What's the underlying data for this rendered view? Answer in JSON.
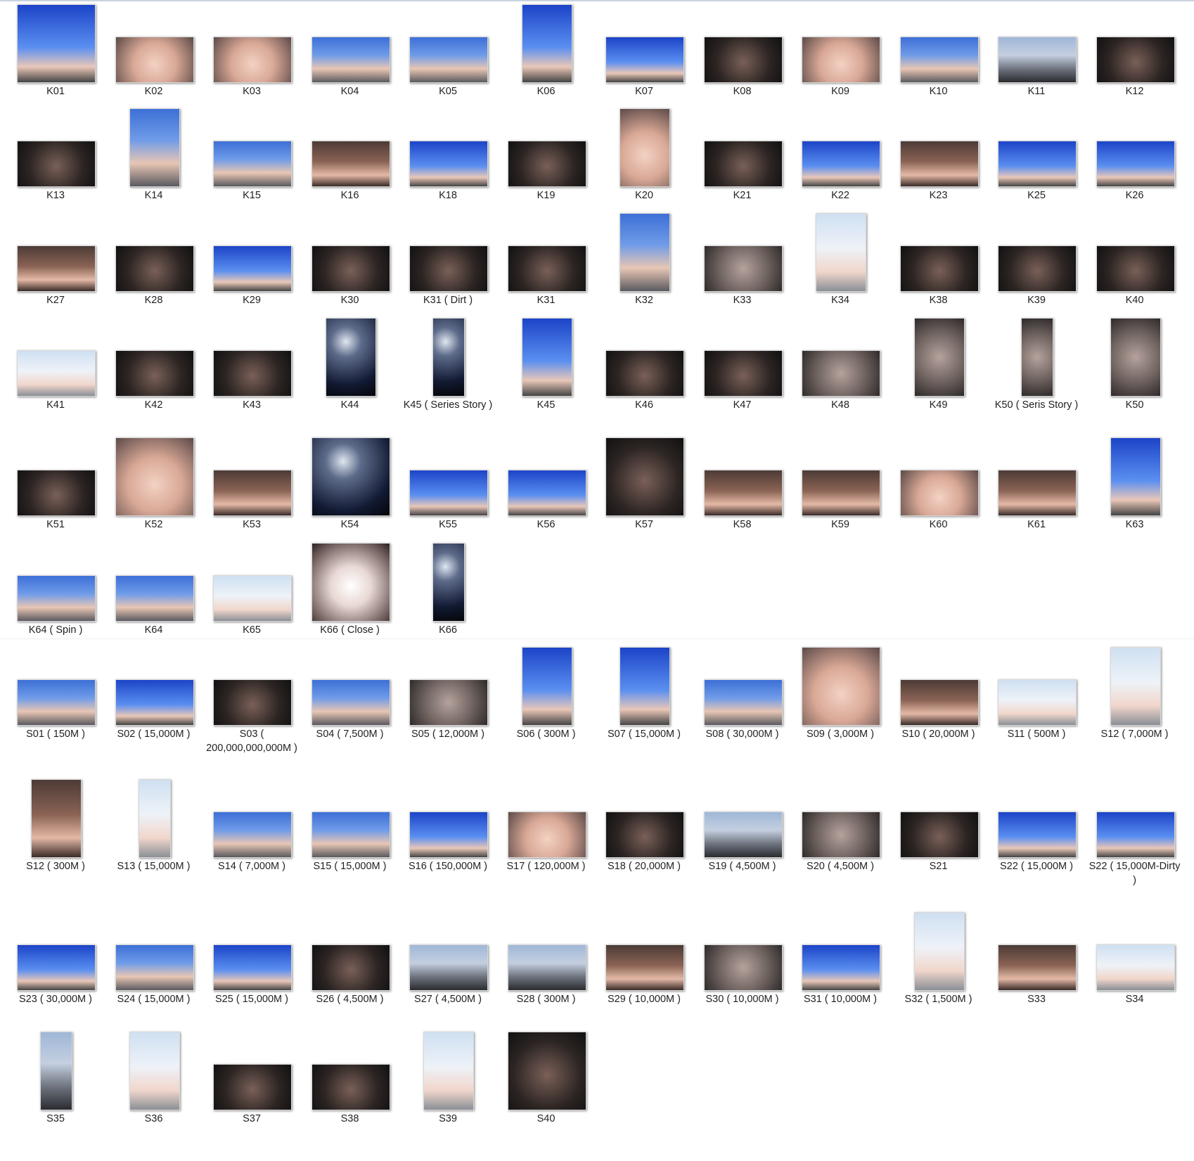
{
  "gallery": {
    "k_series": [
      {
        "label": "K01",
        "shape": "square",
        "tint": "g-blue"
      },
      {
        "label": "K02",
        "shape": "wide",
        "tint": "g-skin"
      },
      {
        "label": "K03",
        "shape": "wide",
        "tint": "g-skin"
      },
      {
        "label": "K04",
        "shape": "wide",
        "tint": "g-sky"
      },
      {
        "label": "K05",
        "shape": "wide",
        "tint": "g-sky"
      },
      {
        "label": "K06",
        "shape": "tall",
        "tint": "g-blue"
      },
      {
        "label": "K07",
        "shape": "wide",
        "tint": "g-blue"
      },
      {
        "label": "K08",
        "shape": "wide",
        "tint": "g-dark"
      },
      {
        "label": "K09",
        "shape": "wide",
        "tint": "g-skin"
      },
      {
        "label": "K10",
        "shape": "wide",
        "tint": "g-sky"
      },
      {
        "label": "K11",
        "shape": "wide",
        "tint": "g-city"
      },
      {
        "label": "K12",
        "shape": "wide",
        "tint": "g-dark"
      },
      {
        "label": "K13",
        "shape": "wide",
        "tint": "g-dark"
      },
      {
        "label": "K14",
        "shape": "tall",
        "tint": "g-sky"
      },
      {
        "label": "K15",
        "shape": "wide",
        "tint": "g-sky"
      },
      {
        "label": "K16",
        "shape": "wide",
        "tint": "g-room"
      },
      {
        "label": "K18",
        "shape": "wide",
        "tint": "g-blue"
      },
      {
        "label": "K19",
        "shape": "wide",
        "tint": "g-dark"
      },
      {
        "label": "K20",
        "shape": "tall",
        "tint": "g-skin"
      },
      {
        "label": "K21",
        "shape": "wide",
        "tint": "g-dark"
      },
      {
        "label": "K22",
        "shape": "wide",
        "tint": "g-blue"
      },
      {
        "label": "K23",
        "shape": "wide",
        "tint": "g-room"
      },
      {
        "label": "K25",
        "shape": "wide",
        "tint": "g-blue"
      },
      {
        "label": "K26",
        "shape": "wide",
        "tint": "g-blue"
      },
      {
        "label": "K27",
        "shape": "wide",
        "tint": "g-room"
      },
      {
        "label": "K28",
        "shape": "wide",
        "tint": "g-dark"
      },
      {
        "label": "K29",
        "shape": "wide",
        "tint": "g-blue"
      },
      {
        "label": "K30",
        "shape": "wide",
        "tint": "g-dark"
      },
      {
        "label": "K31 ( Dirt )",
        "shape": "wide",
        "tint": "g-dark"
      },
      {
        "label": "K31",
        "shape": "wide",
        "tint": "g-dark"
      },
      {
        "label": "K32",
        "shape": "tall",
        "tint": "g-sky"
      },
      {
        "label": "K33",
        "shape": "wide",
        "tint": "g-gray"
      },
      {
        "label": "K34",
        "shape": "tall",
        "tint": "g-pale"
      },
      {
        "label": "K38",
        "shape": "wide",
        "tint": "g-dark"
      },
      {
        "label": "K39",
        "shape": "wide",
        "tint": "g-dark"
      },
      {
        "label": "K40",
        "shape": "wide",
        "tint": "g-dark"
      },
      {
        "label": "K41",
        "shape": "wide",
        "tint": "g-pale"
      },
      {
        "label": "K42",
        "shape": "wide",
        "tint": "g-dark"
      },
      {
        "label": "K43",
        "shape": "wide",
        "tint": "g-dark"
      },
      {
        "label": "K44",
        "shape": "tall",
        "tint": "g-night"
      },
      {
        "label": "K45 ( Series Story )",
        "shape": "narrow",
        "tint": "g-night"
      },
      {
        "label": "K45",
        "shape": "tall",
        "tint": "g-blue"
      },
      {
        "label": "K46",
        "shape": "wide",
        "tint": "g-dark"
      },
      {
        "label": "K47",
        "shape": "wide",
        "tint": "g-dark"
      },
      {
        "label": "K48",
        "shape": "wide",
        "tint": "g-gray"
      },
      {
        "label": "K49",
        "shape": "tall",
        "tint": "g-gray"
      },
      {
        "label": "K50 ( Seris Story )",
        "shape": "narrow",
        "tint": "g-gray"
      },
      {
        "label": "K50",
        "shape": "tall",
        "tint": "g-gray"
      },
      {
        "label": "K51",
        "shape": "wide",
        "tint": "g-dark"
      },
      {
        "label": "K52",
        "shape": "square",
        "tint": "g-skin"
      },
      {
        "label": "K53",
        "shape": "wide",
        "tint": "g-room"
      },
      {
        "label": "K54",
        "shape": "square",
        "tint": "g-night"
      },
      {
        "label": "K55",
        "shape": "wide",
        "tint": "g-blue"
      },
      {
        "label": "K56",
        "shape": "wide",
        "tint": "g-blue"
      },
      {
        "label": "K57",
        "shape": "square",
        "tint": "g-dark"
      },
      {
        "label": "K58",
        "shape": "wide",
        "tint": "g-room"
      },
      {
        "label": "K59",
        "shape": "wide",
        "tint": "g-room"
      },
      {
        "label": "K60",
        "shape": "wide",
        "tint": "g-skin"
      },
      {
        "label": "K61",
        "shape": "wide",
        "tint": "g-room"
      },
      {
        "label": "K63",
        "shape": "tall",
        "tint": "g-blue"
      },
      {
        "label": "K64 ( Spin )",
        "shape": "wide",
        "tint": "g-sky"
      },
      {
        "label": "K64",
        "shape": "wide",
        "tint": "g-sky"
      },
      {
        "label": "K65",
        "shape": "wide",
        "tint": "g-pale"
      },
      {
        "label": "K66 ( Close )",
        "shape": "square",
        "tint": "g-light"
      },
      {
        "label": "K66",
        "shape": "narrow",
        "tint": "g-night"
      }
    ],
    "s_series": [
      {
        "label": "S01 ( 150M )",
        "shape": "wide",
        "tint": "g-sky"
      },
      {
        "label": "S02 ( 15,000M )",
        "shape": "wide",
        "tint": "g-blue"
      },
      {
        "label": "S03 ( 200,000,000,000M )",
        "shape": "wide",
        "tint": "g-dark"
      },
      {
        "label": "S04 ( 7,500M )",
        "shape": "wide",
        "tint": "g-sky"
      },
      {
        "label": "S05 ( 12,000M )",
        "shape": "wide",
        "tint": "g-gray"
      },
      {
        "label": "S06 ( 300M )",
        "shape": "tall",
        "tint": "g-blue"
      },
      {
        "label": "S07 ( 15,000M )",
        "shape": "tall",
        "tint": "g-blue"
      },
      {
        "label": "S08 ( 30,000M )",
        "shape": "wide",
        "tint": "g-sky"
      },
      {
        "label": "S09 ( 3,000M )",
        "shape": "square",
        "tint": "g-skin"
      },
      {
        "label": "S10 ( 20,000M )",
        "shape": "wide",
        "tint": "g-room"
      },
      {
        "label": "S11 ( 500M )",
        "shape": "wide",
        "tint": "g-pale"
      },
      {
        "label": "S12 ( 7,000M )",
        "shape": "tall",
        "tint": "g-pale"
      },
      {
        "label": "S12 ( 300M )",
        "shape": "tall",
        "tint": "g-room"
      },
      {
        "label": "S13 ( 15,000M )",
        "shape": "narrow",
        "tint": "g-pale"
      },
      {
        "label": "S14 ( 7,000M )",
        "shape": "wide",
        "tint": "g-sky"
      },
      {
        "label": "S15 ( 15,000M )",
        "shape": "wide",
        "tint": "g-sky"
      },
      {
        "label": "S16 ( 150,000M )",
        "shape": "wide",
        "tint": "g-blue"
      },
      {
        "label": "S17 ( 120,000M )",
        "shape": "wide",
        "tint": "g-skin"
      },
      {
        "label": "S18 ( 20,000M )",
        "shape": "wide",
        "tint": "g-dark"
      },
      {
        "label": "S19 ( 4,500M )",
        "shape": "wide",
        "tint": "g-city"
      },
      {
        "label": "S20 ( 4,500M )",
        "shape": "wide",
        "tint": "g-gray"
      },
      {
        "label": "S21",
        "shape": "wide",
        "tint": "g-dark"
      },
      {
        "label": "S22 ( 15,000M )",
        "shape": "wide",
        "tint": "g-blue"
      },
      {
        "label": "S22 ( 15,000M-Dirty )",
        "shape": "wide",
        "tint": "g-blue"
      },
      {
        "label": "S23 ( 30,000M )",
        "shape": "wide",
        "tint": "g-blue"
      },
      {
        "label": "S24 ( 15,000M )",
        "shape": "wide",
        "tint": "g-sky"
      },
      {
        "label": "S25 ( 15,000M )",
        "shape": "wide",
        "tint": "g-blue"
      },
      {
        "label": "S26 ( 4,500M )",
        "shape": "wide",
        "tint": "g-dark"
      },
      {
        "label": "S27 ( 4,500M )",
        "shape": "wide",
        "tint": "g-city"
      },
      {
        "label": "S28  ( 300M )",
        "shape": "wide",
        "tint": "g-city"
      },
      {
        "label": "S29 ( 10,000M )",
        "shape": "wide",
        "tint": "g-room"
      },
      {
        "label": "S30  ( 10,000M )",
        "shape": "wide",
        "tint": "g-gray"
      },
      {
        "label": "S31  ( 10,000M )",
        "shape": "wide",
        "tint": "g-blue"
      },
      {
        "label": "S32  ( 1,500M )",
        "shape": "tall",
        "tint": "g-pale"
      },
      {
        "label": "S33",
        "shape": "wide",
        "tint": "g-room"
      },
      {
        "label": "S34",
        "shape": "wide",
        "tint": "g-pale"
      },
      {
        "label": "S35",
        "shape": "narrow",
        "tint": "g-city"
      },
      {
        "label": "S36",
        "shape": "tall",
        "tint": "g-pale"
      },
      {
        "label": "S37",
        "shape": "wide",
        "tint": "g-dark"
      },
      {
        "label": "S38",
        "shape": "wide",
        "tint": "g-dark"
      },
      {
        "label": "S39",
        "shape": "tall",
        "tint": "g-pale"
      },
      {
        "label": "S40",
        "shape": "square",
        "tint": "g-dark"
      }
    ]
  }
}
